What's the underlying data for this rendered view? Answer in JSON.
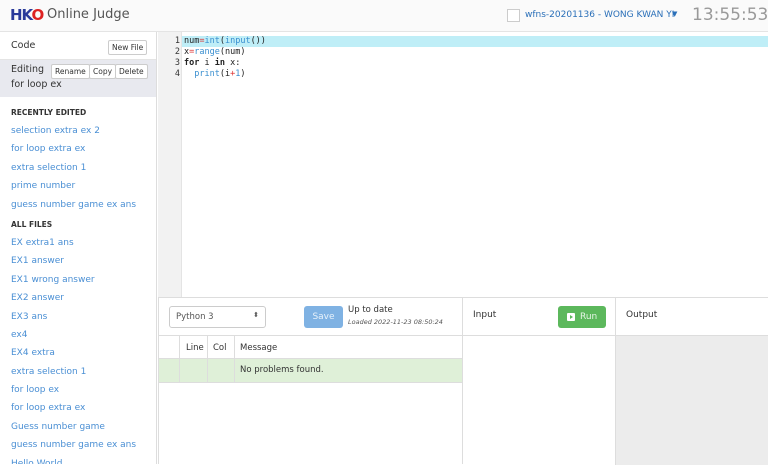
{
  "header": {
    "logo": "HKO",
    "title": "Online Judge",
    "user": "wfns-20201136 - WONG KWAN YI",
    "clock": "13:55:53"
  },
  "sidebar": {
    "code_label": "Code",
    "new_file": "New File",
    "editing_label": "Editing",
    "editing_file": "for loop ex",
    "rename": "Rename",
    "copy": "Copy",
    "delete": "Delete",
    "recent_title": "RECENTLY EDITED",
    "recent": [
      "selection extra ex 2",
      "for loop extra ex",
      "extra selection 1",
      "prime number",
      "guess number game ex ans"
    ],
    "all_title": "ALL FILES",
    "all": [
      "EX extra1 ans",
      "EX1 answer",
      "EX1 wrong answer",
      "EX2 answer",
      "EX3 ans",
      "ex4",
      "EX4 extra",
      "extra selection 1",
      "for loop ex",
      "for loop extra ex",
      "Guess number game",
      "guess number game ex ans",
      "Hello World"
    ]
  },
  "editor": {
    "line_numbers": [
      "1",
      "2",
      "3",
      "4"
    ]
  },
  "toolbar": {
    "language": "Python 3",
    "save": "Save",
    "status": "Up to date",
    "loaded": "Loaded 2022-11-23 08:50:24"
  },
  "problems": {
    "columns": [
      "",
      "Line",
      "Col",
      "Message"
    ],
    "message": "No problems found."
  },
  "input": {
    "title": "Input",
    "run": "Run"
  },
  "output": {
    "title": "Output"
  }
}
